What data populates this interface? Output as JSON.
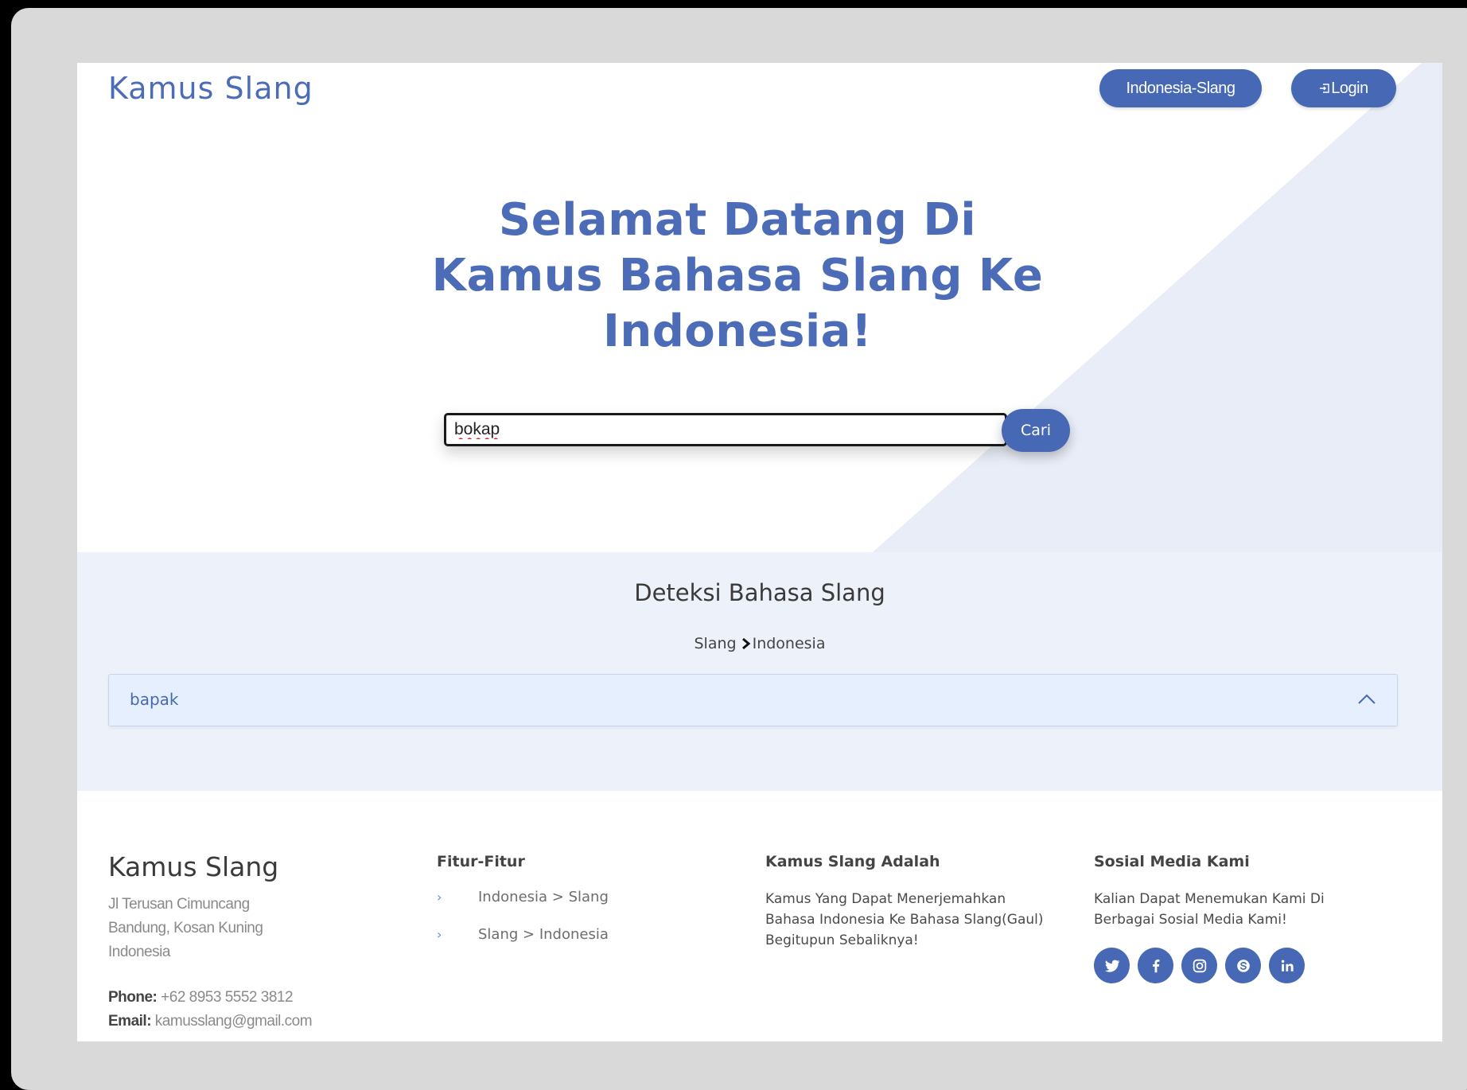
{
  "header": {
    "brand": "Kamus Slang",
    "nav": {
      "indo_slang_label": "Indonesia-Slang",
      "login_label": "Login"
    }
  },
  "hero": {
    "title_lines": [
      "Selamat Datang Di",
      "Kamus Bahasa Slang Ke",
      "Indonesia!"
    ],
    "search": {
      "value": "bokap",
      "button_label": "Cari"
    }
  },
  "detect": {
    "title": "Deteksi Bahasa Slang",
    "breadcrumb_from": "Slang",
    "breadcrumb_to": "Indonesia",
    "result": "bapak"
  },
  "footer": {
    "brand": "Kamus Slang",
    "address_lines": [
      "Jl Terusan Cimuncang",
      "Bandung, Kosan Kuning",
      "Indonesia"
    ],
    "phone_label": "Phone:",
    "phone": " +62 8953 5552 3812",
    "email_label": "Email:",
    "email": " kamusslang@gmail.com",
    "features_title": "Fitur-Fitur",
    "features": [
      "Indonesia > Slang",
      "Slang > Indonesia"
    ],
    "about_title": "Kamus Slang Adalah",
    "about_text": "Kamus Yang Dapat Menerjemahkan Bahasa Indonesia Ke Bahasa Slang(Gaul) Begitupun Sebaliknya!",
    "social_title": "Sosial Media Kami",
    "social_text": "Kalian Dapat Menemukan Kami Di Berbagai Sosial Media Kami!",
    "social_icons": [
      "twitter-icon",
      "facebook-icon",
      "instagram-icon",
      "skype-icon",
      "linkedin-icon"
    ]
  },
  "colors": {
    "primary": "#4769b5",
    "brand_text": "#4c6cb8",
    "section_bg": "#edf1f9",
    "result_bg": "#e6effd",
    "diagonal": "#e9edf7",
    "frame": "#d9d9d9"
  }
}
